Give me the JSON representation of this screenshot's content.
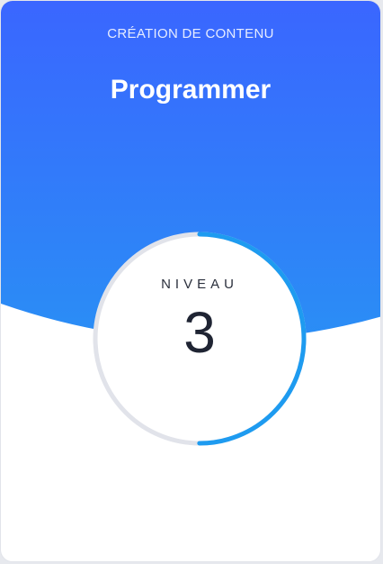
{
  "card": {
    "category": "CRÉATION DE CONTENU",
    "title": "Programmer"
  },
  "level": {
    "label": "NIVEAU",
    "value": "3",
    "progress_fraction": 0.5
  },
  "colors": {
    "gradient_top": "#3a66ff",
    "gradient_bottom": "#2a8ef5",
    "ring_track": "#e1e3ea",
    "ring_progress": "#1e9bf0",
    "card_background": "#ffffff"
  }
}
